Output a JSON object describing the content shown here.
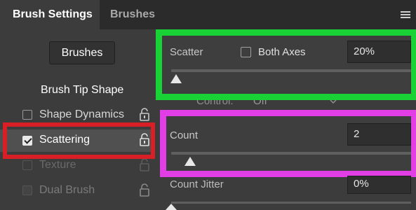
{
  "tabs": [
    {
      "label": "Brush Settings",
      "active": true
    },
    {
      "label": "Brushes",
      "active": false
    }
  ],
  "sidebar": {
    "brushes_button": "Brushes",
    "brush_tip_shape": "Brush Tip Shape",
    "options": [
      {
        "label": "Shape Dynamics",
        "checked": false,
        "enabled": true
      },
      {
        "label": "Scattering",
        "checked": true,
        "enabled": true
      },
      {
        "label": "Texture",
        "checked": false,
        "enabled": false
      },
      {
        "label": "Dual Brush",
        "checked": false,
        "enabled": false
      }
    ]
  },
  "scatter": {
    "label": "Scatter",
    "both_axes_label": "Both Axes",
    "value": "20%",
    "slider_fraction": 0.02
  },
  "control": {
    "label": "Control:",
    "value": "Off"
  },
  "count": {
    "label": "Count",
    "value": "2",
    "slider_fraction": 0.08
  },
  "count_jitter": {
    "label": "Count Jitter",
    "value": "0%"
  },
  "highlight_colors": {
    "green": "#18d236",
    "magenta": "#e23ee6",
    "red": "#d81f26"
  }
}
